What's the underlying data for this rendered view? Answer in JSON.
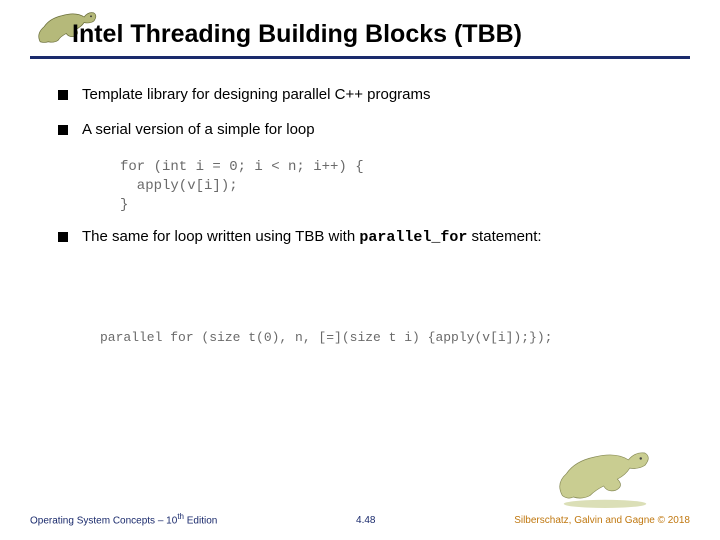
{
  "slide": {
    "title": "Intel Threading Building Blocks (TBB)",
    "bullets": {
      "b1": "Template library for designing parallel C++ programs",
      "b2": "A serial version of a simple for loop",
      "b3_pre": "The same for loop written using TBB with ",
      "b3_code": "parallel_for",
      "b3_post": " statement:"
    },
    "code": {
      "serial": "for (int i = 0; i < n; i++) {\n  apply(v[i]);\n}",
      "parallel": "parallel for (size t(0), n, [=](size t i) {apply(v[i]);});"
    },
    "footer": {
      "left_pre": "Operating System Concepts – 10",
      "left_sup": "th",
      "left_post": " Edition",
      "center": "4.48",
      "right": "Silberschatz, Galvin and Gagne © 2018"
    }
  }
}
